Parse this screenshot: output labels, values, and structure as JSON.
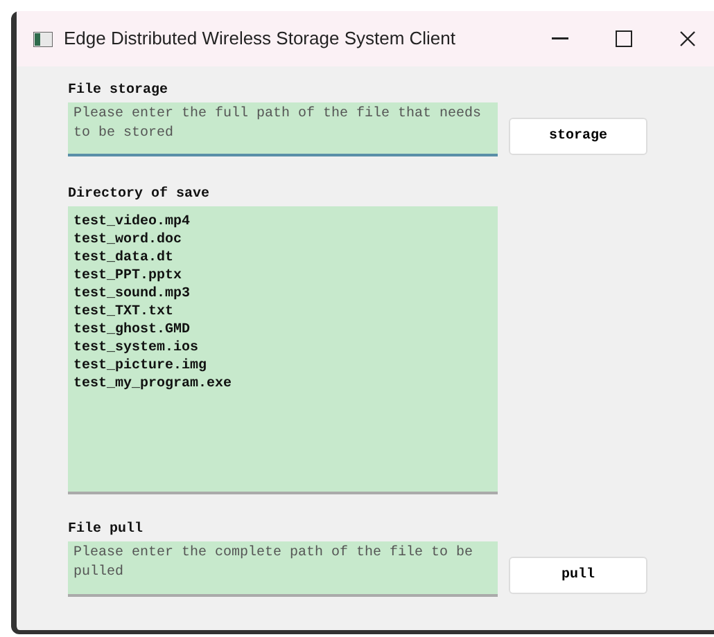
{
  "window": {
    "title": "Edge Distributed Wireless Storage System Client"
  },
  "storage": {
    "label": "File storage",
    "placeholder": "Please enter the full path of the file that needs to be stored",
    "button": "storage"
  },
  "directory": {
    "label": "Directory of save",
    "files": [
      "test_video.mp4",
      "test_word.doc",
      "test_data.dt",
      "test_PPT.pptx",
      "test_sound.mp3",
      "test_TXT.txt",
      "test_ghost.GMD",
      "test_system.ios",
      "test_picture.img",
      "test_my_program.exe"
    ]
  },
  "pull": {
    "label": "File pull",
    "placeholder": "Please enter the complete path of the file to be pulled",
    "button": "pull"
  }
}
